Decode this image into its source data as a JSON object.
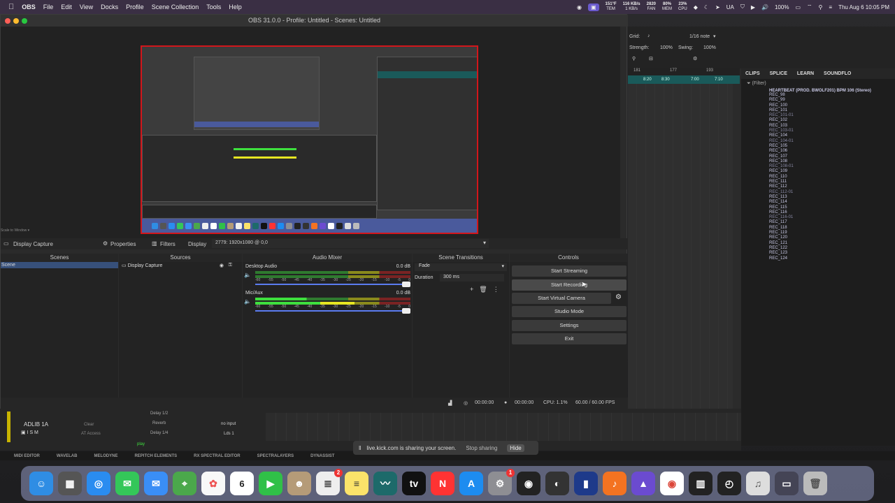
{
  "menubar": {
    "apple": "",
    "app": "OBS",
    "items": [
      "File",
      "Edit",
      "View",
      "Docks",
      "Profile",
      "Scene Collection",
      "Tools",
      "Help"
    ],
    "temp": "151°F",
    "temp_sub": "TEM",
    "net": "116 KB/s",
    "net_sub": "1 KB/s",
    "fan": "2820",
    "fan_sub": "FAN",
    "mem": "80%",
    "mem_sub": "MEM",
    "cpu": "23%",
    "cpu_sub": "CPU",
    "lang": "UA",
    "battery": "100%",
    "datetime": "Thu Aug 6  10:05 PM"
  },
  "obs": {
    "title": "OBS 31.0.0 - Profile: Untitled - Scenes: Untitled",
    "scale_label": "Scale to Window",
    "source_toolbar": {
      "source": "Display Capture",
      "properties": "Properties",
      "filters": "Filters",
      "display_label": "Display",
      "display_value": "2779: 1920x1080 @ 0,0"
    },
    "scenes_title": "Scenes",
    "scene_item": "Scene",
    "sources_title": "Sources",
    "source_item": "Display Capture",
    "mixer_title": "Audio Mixer",
    "channels": [
      {
        "name": "Desktop Audio",
        "db": "0.0 dB"
      },
      {
        "name": "Mic/Aux",
        "db": "0.0 dB"
      }
    ],
    "ticks": [
      "-60",
      "-55",
      "-50",
      "-45",
      "-40",
      "-35",
      "-30",
      "-25",
      "-20",
      "-15",
      "-10",
      "-5",
      "0"
    ],
    "transitions_title": "Scene Transitions",
    "transition": "Fade",
    "duration_label": "Duration",
    "duration_value": "300 ms",
    "controls_title": "Controls",
    "controls": [
      "Start Streaming",
      "Start Recording",
      "Start Virtual Camera",
      "Studio Mode",
      "Settings",
      "Exit"
    ],
    "status": {
      "live_time": "00:00:00",
      "rec_time": "00:00:00",
      "cpu": "CPU: 1.1%",
      "fps": "60.00 / 60.00 FPS"
    }
  },
  "daw": {
    "grid": "Grid:",
    "note": "1/16 note",
    "strength_label": "Strength:",
    "strength": "100%",
    "swing_label": "Swing:",
    "swing": "100%",
    "ruler": [
      "181",
      "177",
      "193"
    ],
    "ruler_times": [
      "8:20",
      "8:30",
      "7:00",
      "7:10"
    ],
    "tabs": [
      "CLIPS",
      "SPLICE",
      "LEARN",
      "SOUNDFLO"
    ],
    "filter": "(Filter)",
    "root": "HEARTBEAT (PROD. BWOLF201) BPM 106 (Stereo)",
    "files": [
      "REC_98",
      "REC_99",
      "REC_100",
      "REC_101",
      "REC_101-01",
      "REC_102",
      "REC_103",
      "REC_103-01",
      "REC_104",
      "REC_104-01",
      "REC_105",
      "REC_106",
      "REC_107",
      "REC_108",
      "REC_108-01",
      "REC_109",
      "REC_110",
      "REC_111",
      "REC_112",
      "REC_112-01",
      "REC_113",
      "REC_114",
      "REC_115",
      "REC_116",
      "REC_116-01",
      "REC_117",
      "REC_118",
      "REC_119",
      "REC_120",
      "REC_121",
      "REC_122",
      "REC_123",
      "REC_124"
    ]
  },
  "logic": {
    "track": "ADLIB 1A",
    "no_input": "no input",
    "lds": "Lds 1",
    "reverb": "Reverb",
    "delay1": "Delay 1/2",
    "delay2": "Delay 1/4",
    "clear": "Clear",
    "at_access": "AT Access",
    "play": "play"
  },
  "plugins": [
    "MIDI EDITOR",
    "WAVELAB",
    "MELODYNE",
    "REPITCH ELEMENTS",
    "RX SPECTRAL EDITOR",
    "SPECTRALAYERS",
    "DYNASSIST"
  ],
  "share": {
    "text": "live.kick.com is sharing your screen.",
    "stop": "Stop sharing",
    "hide": "Hide"
  },
  "dock": {
    "calendar_day": "6",
    "badge1": "2",
    "badge2": "1"
  }
}
